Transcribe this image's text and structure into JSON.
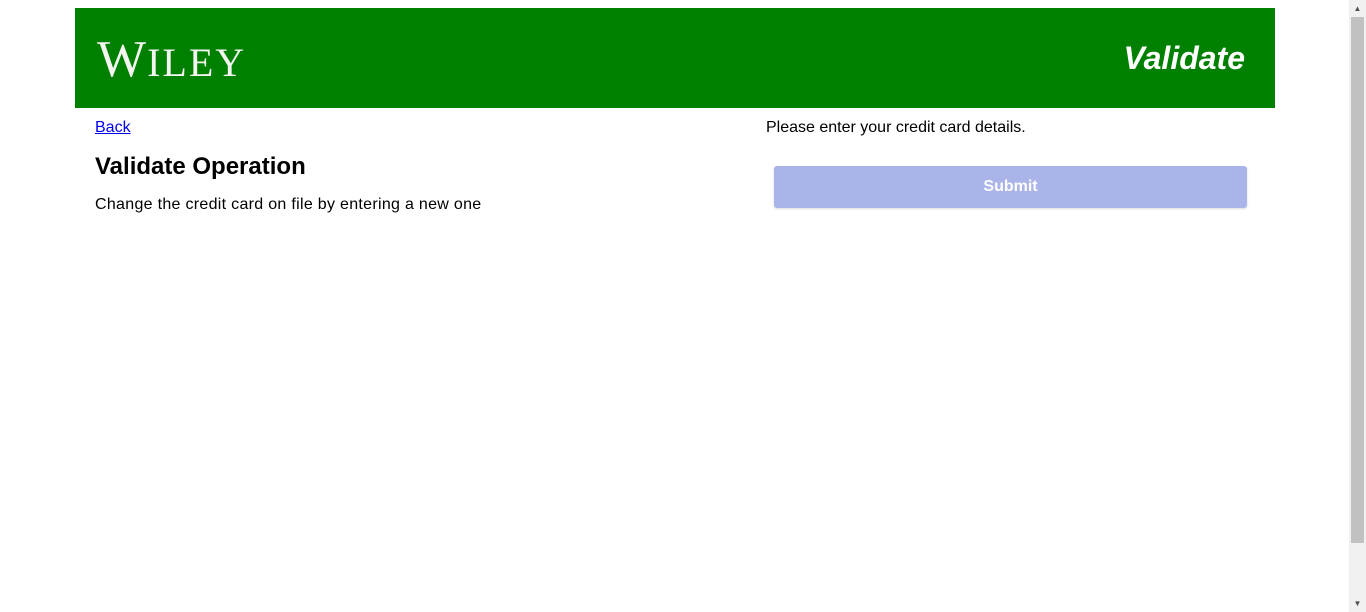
{
  "header": {
    "logo_text": "WILEY",
    "logo_first": "W",
    "logo_rest": "ILEY",
    "title": "Validate"
  },
  "left": {
    "back_link": "Back",
    "operation_title": "Validate Operation",
    "operation_description": "Change the credit card on file by entering a new one"
  },
  "right": {
    "instructions": "Please enter your credit card details.",
    "submit_label": "Submit"
  },
  "colors": {
    "header_bg": "#008000",
    "submit_bg": "#aab4e8",
    "link": "#0000ee"
  },
  "icons": {
    "scroll_up": "scroll-up-arrow-icon",
    "scroll_down": "scroll-down-arrow-icon"
  }
}
